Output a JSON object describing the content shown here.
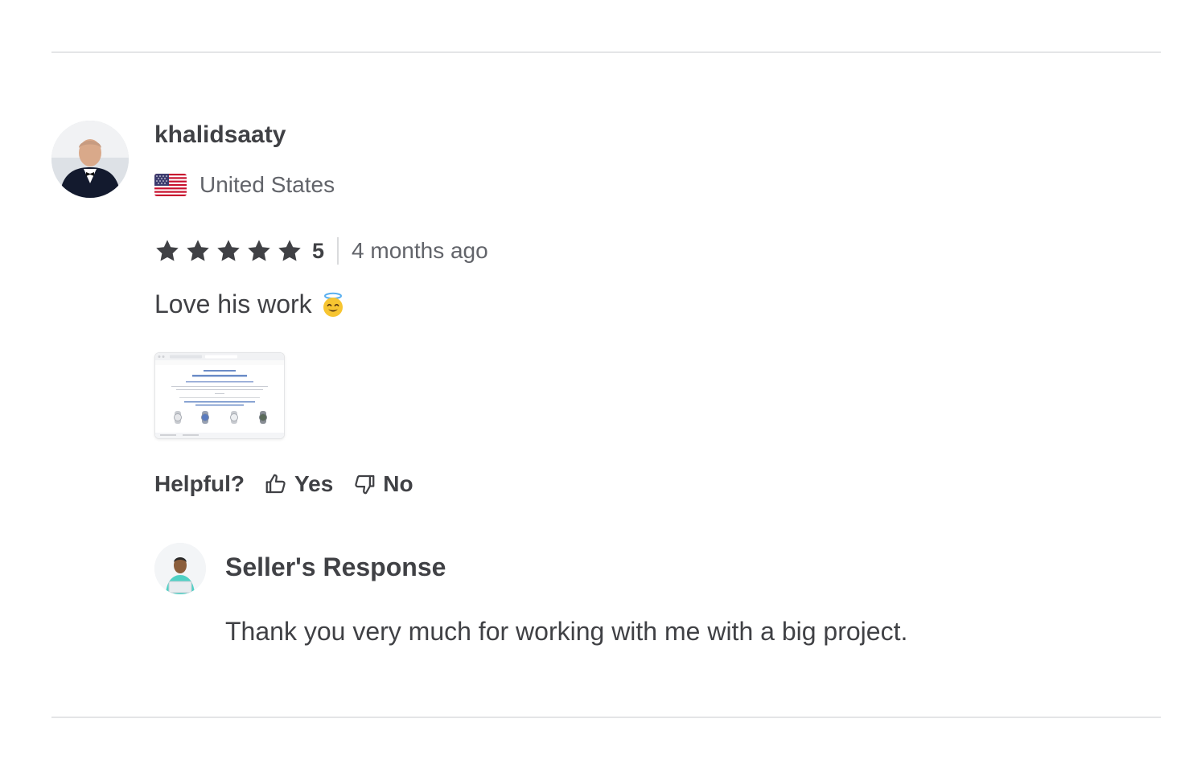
{
  "review": {
    "username": "khalidsaaty",
    "country": "United States",
    "flag_icon": "us-flag-icon",
    "rating": {
      "stars": 5,
      "value": "5",
      "star_color": "#404145"
    },
    "time_ago": "4 months ago",
    "text": "Love his work",
    "emoji": "smiling-face-with-halo",
    "helpful": {
      "label": "Helpful?",
      "yes_label": "Yes",
      "no_label": "No"
    }
  },
  "seller_response": {
    "title": "Seller's Response",
    "text": "Thank you very much for working with me with a big project."
  },
  "colors": {
    "text_primary": "#404145",
    "text_secondary": "#62646a",
    "divider": "#e4e5e7"
  }
}
